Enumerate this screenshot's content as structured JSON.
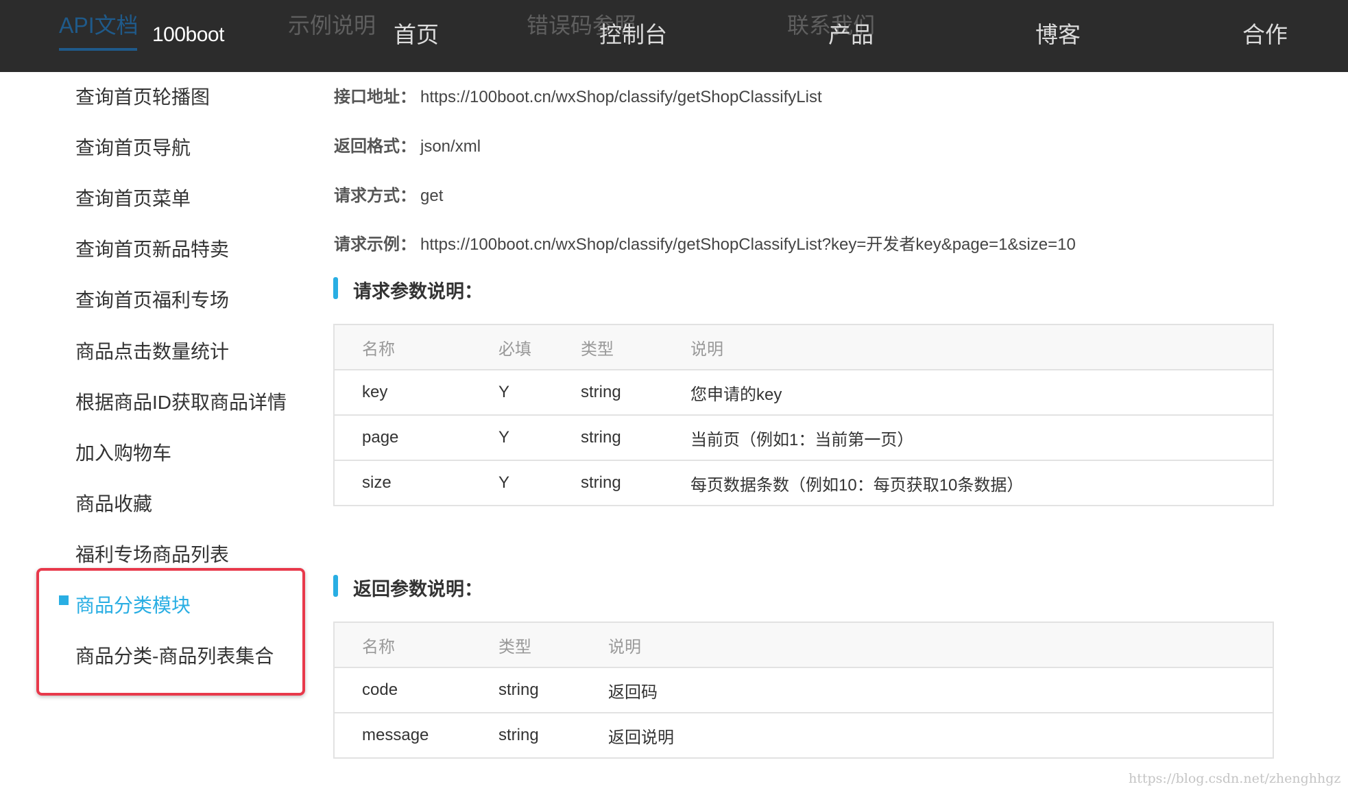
{
  "header": {
    "ghost_nav": [
      "API文档",
      "示例说明",
      "错误码参照",
      "联系我们"
    ],
    "logo": "100boot",
    "nav": [
      "首页",
      "控制台",
      "产品",
      "博客",
      "合作"
    ]
  },
  "sidebar": {
    "items": [
      "查询首页轮播图",
      "查询首页导航",
      "查询首页菜单",
      "查询首页新品特卖",
      "查询首页福利专场",
      "商品点击数量统计",
      "根据商品ID获取商品详情",
      "加入购物车",
      "商品收藏",
      "福利专场商品列表",
      "商品分类模块",
      "商品分类-商品列表集合"
    ],
    "active_item": "商品分类模块"
  },
  "api_info": {
    "url_label": "接口地址：",
    "url": "https://100boot.cn/wxShop/classify/getShopClassifyList",
    "format_label": "返回格式：",
    "format": "json/xml",
    "method_label": "请求方式：",
    "method": "get",
    "example_label": "请求示例：",
    "example": "https://100boot.cn/wxShop/classify/getShopClassifyList?key=开发者key&page=1&size=10"
  },
  "request_params": {
    "title": "请求参数说明：",
    "headers": [
      "名称",
      "必填",
      "类型",
      "说明"
    ],
    "rows": [
      [
        "key",
        "Y",
        "string",
        "您申请的key"
      ],
      [
        "page",
        "Y",
        "string",
        "当前页（例如1：当前第一页）"
      ],
      [
        "size",
        "Y",
        "string",
        "每页数据条数（例如10：每页获取10条数据）"
      ]
    ]
  },
  "response_params": {
    "title": "返回参数说明：",
    "headers": [
      "名称",
      "类型",
      "说明"
    ],
    "rows": [
      [
        "code",
        "string",
        "返回码"
      ],
      [
        "message",
        "string",
        "返回说明"
      ]
    ]
  },
  "watermark": "https://blog.csdn.net/zhenghhgz",
  "colors": {
    "topbar_bg": "#2c2c2c",
    "accent": "#29aee3",
    "highlight_border": "#e8394b"
  }
}
